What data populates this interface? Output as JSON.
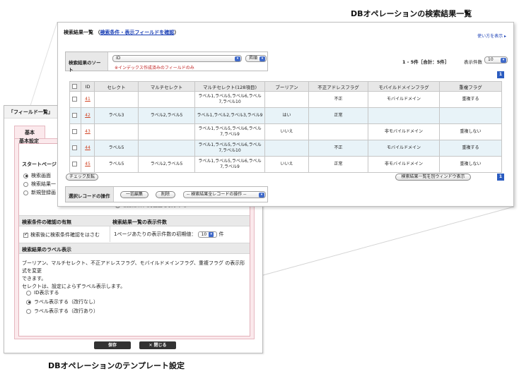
{
  "captions": {
    "top_right": "DBオペレーションの検索結果一覧",
    "bottom": "DBオペレーションのテンプレート設定"
  },
  "template_window": {
    "title": "「フィールド一覧」",
    "tab": "基本",
    "section_title": "基本設定",
    "start_label": "スタートページ",
    "start_options": [
      "検索画面",
      "検索結果一",
      "新規登録画"
    ],
    "search_input_option": "検索条件入力画面を表示する",
    "confirm_title": "検索条件の確認の有無",
    "confirm_check": "検索後に検索条件確認をはさむ",
    "count_title": "検索結果一覧の表示件数",
    "count_text": "1ページあたりの表示件数の初期値：",
    "count_value": "10",
    "count_unit": "件",
    "label_title": "検索結果のラベル表示",
    "label_desc1": "ブーリアン、マルチセレクト、不正アドレスフラグ、モバイルドメインフラグ、重複フラグ の表示形式を変更",
    "label_desc2": "できます。",
    "label_desc3": "セレクトは、設定によらずラベル表示します。",
    "label_options": [
      "ID表示する",
      "ラベル表示する（改行なし）",
      "ラベル表示する（改行あり）"
    ],
    "save_btn": "保存",
    "close_btn": "✕ 閉じる"
  },
  "results_window": {
    "title": "検索結果一覧",
    "title_link": "検索条件・表示フィールドを確認",
    "help": "使い方を表示 ▸",
    "sort_label": "検索結果のソート",
    "sort_field": "ID",
    "sort_order": "昇順",
    "sort_note": "※インデックス作成済みのフィールドのみ",
    "count_info": "1 - 5件［合計：5件］",
    "per_page_label": "表示件数",
    "per_page_value": "10",
    "page_number": "1",
    "columns": [
      "",
      "ID",
      "セレクト",
      "マルチセレクト",
      "マルチセレクト(128項目)",
      "ブーリアン",
      "不正アドレスフラグ",
      "モバイルドメインフラグ",
      "重複フラグ"
    ],
    "rows": [
      {
        "id": "41",
        "select": "",
        "multi": "",
        "multi128": "ラベル1,ラベル5,ラベル6,ラベル7,ラベル10",
        "bool": "",
        "bad_addr": "不正",
        "mobile": "モバイルドメイン",
        "dup": "重複する"
      },
      {
        "id": "42",
        "select": "ラベル3",
        "multi": "ラベル2,ラベル5",
        "multi128": "ラベル1,ラベル2,ラベル3,ラベル9",
        "bool": "はい",
        "bad_addr": "正常",
        "mobile": "",
        "dup": ""
      },
      {
        "id": "43",
        "select": "",
        "multi": "",
        "multi128": "ラベル1,ラベル5,ラベル6,ラベル7,ラベル9",
        "bool": "いいえ",
        "bad_addr": "",
        "mobile": "非モバイルドメイン",
        "dup": "重複しない"
      },
      {
        "id": "44",
        "select": "ラベル5",
        "multi": "",
        "multi128": "ラベル1,ラベル5,ラベル6,ラベル7,ラベル10",
        "bool": "",
        "bad_addr": "不正",
        "mobile": "モバイルドメイン",
        "dup": "重複する"
      },
      {
        "id": "45",
        "select": "ラベル5",
        "multi": "ラベル2,ラベル5",
        "multi128": "ラベル1,ラベル5,ラベル6,ラベル7,ラベル9",
        "bool": "いいえ",
        "bad_addr": "正常",
        "mobile": "非モバイルドメイン",
        "dup": "重複しない"
      }
    ],
    "check_toggle": "チェック反転",
    "open_window_btn": "検索結果一覧を別ウィンドウ表示",
    "ops_label": "選択レコードの操作",
    "bulk_edit": "一括編集",
    "delete": "削除",
    "all_ops_select": "-- 検索結果全レコードの操作 --"
  },
  "colors": {
    "accent": "#2b5cc0",
    "link": "#1a3fb5",
    "id_link": "#d04020",
    "row_alt": "#e8f3f8",
    "pink": "#fbe9ec"
  }
}
